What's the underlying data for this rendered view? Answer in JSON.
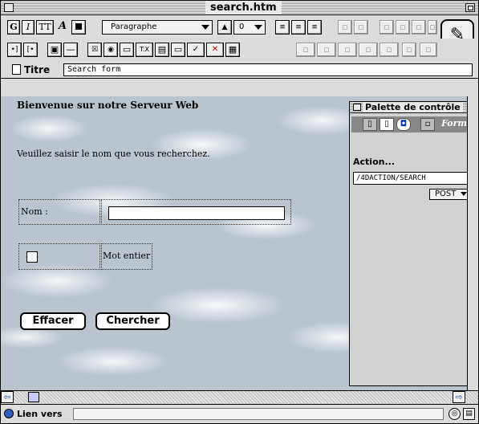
{
  "window": {
    "title": "search.htm"
  },
  "toolbar1": {
    "bold": "G",
    "italic": "I",
    "teletype": "TT",
    "font_size": "A",
    "style_select": "Paragraphe",
    "size_value": "0",
    "size_up": "▲",
    "size_down": "▼"
  },
  "title_field": {
    "label": "Titre",
    "value": "Search form"
  },
  "page": {
    "welcome": "Bienvenue sur notre Serveur Web",
    "prompt": "Veuillez saisir le nom que vous recherchez.",
    "nom_label": "Nom :",
    "nom_value": "",
    "checkbox_label": "Mot entier",
    "checkbox_checked": false,
    "reset_button": "Effacer",
    "submit_button": "Chercher"
  },
  "palette": {
    "title": "Palette de contrôle",
    "tab_form": "Form.",
    "action_label": "Action...",
    "action_value": "/4DACTION/SEARCH",
    "method": "POST"
  },
  "status": {
    "link_label": "Lien vers",
    "link_value": ""
  },
  "colors": {
    "chrome": "#dcdcdc",
    "sky": "#b9c4cf",
    "accent": "#2050c0"
  }
}
